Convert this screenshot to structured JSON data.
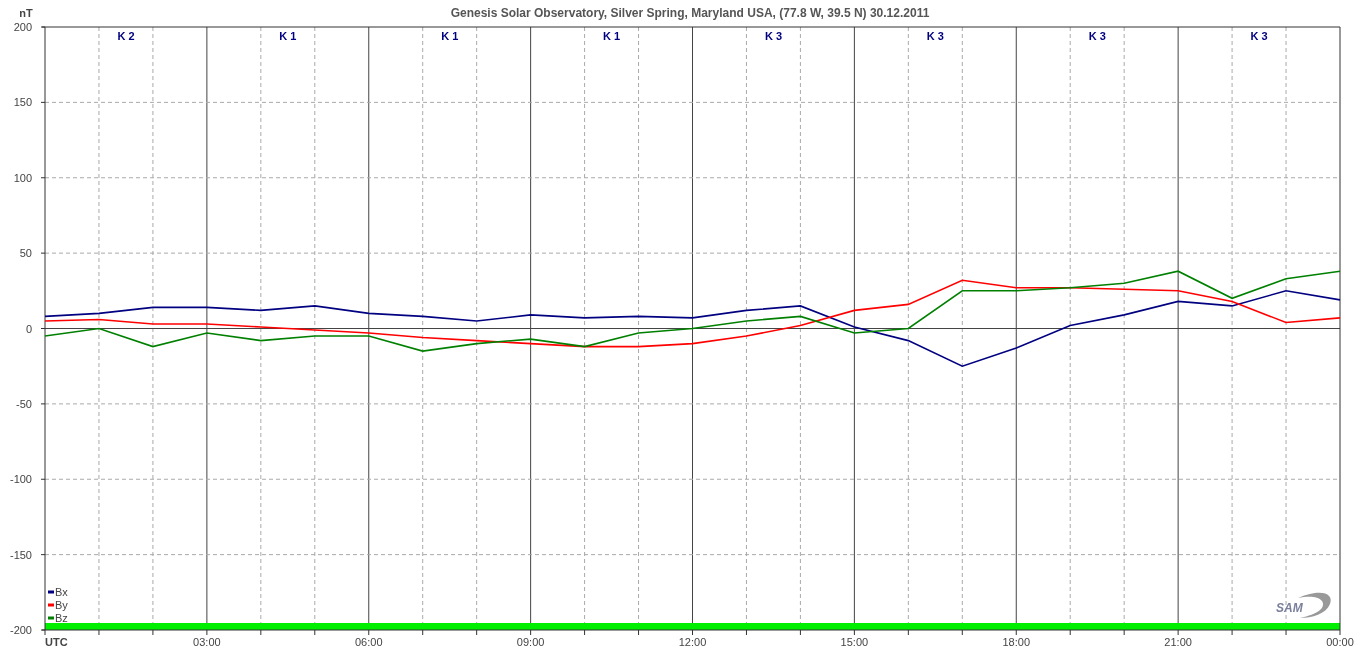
{
  "title": "Genesis Solar Observatory, Silver Spring, Maryland USA, (77.8 W, 39.5 N)  30.12.2011",
  "k_indices": [
    {
      "label": "K 2"
    },
    {
      "label": "K 1"
    },
    {
      "label": "K 1"
    },
    {
      "label": "K 1"
    },
    {
      "label": "K 3"
    },
    {
      "label": "K 3"
    },
    {
      "label": "K 3"
    },
    {
      "label": "K 3"
    }
  ],
  "logo": "SAM",
  "chart_data": {
    "type": "line",
    "ylabel": "nT",
    "x": [
      0,
      1,
      2,
      3,
      4,
      5,
      6,
      7,
      8,
      9,
      10,
      11,
      12,
      13,
      14,
      15,
      16,
      17,
      18,
      19,
      20,
      21,
      22,
      23,
      24
    ],
    "xlim": [
      0,
      24
    ],
    "ylim": [
      -200,
      200
    ],
    "grid": true,
    "legend": "lower left",
    "xticks": [
      {
        "value": 0,
        "label": "UTC"
      },
      {
        "value": 3,
        "label": "03:00"
      },
      {
        "value": 6,
        "label": "06:00"
      },
      {
        "value": 9,
        "label": "09:00"
      },
      {
        "value": 12,
        "label": "12:00"
      },
      {
        "value": 15,
        "label": "15:00"
      },
      {
        "value": 18,
        "label": "18:00"
      },
      {
        "value": 21,
        "label": "21:00"
      },
      {
        "value": 24,
        "label": "00:00"
      }
    ],
    "yticks": [
      -200,
      -150,
      -100,
      -50,
      0,
      50,
      100,
      150,
      200
    ],
    "series": [
      {
        "name": "Bx",
        "color": "#000080",
        "values": [
          8,
          10,
          14,
          14,
          12,
          15,
          10,
          8,
          5,
          9,
          7,
          8,
          7,
          12,
          15,
          1,
          -8,
          -25,
          -13,
          2,
          9,
          18,
          15,
          25,
          19
        ]
      },
      {
        "name": "By",
        "color": "#ff0000",
        "values": [
          5,
          6,
          3,
          3,
          1,
          -1,
          -3,
          -6,
          -8,
          -10,
          -12,
          -12,
          -10,
          -5,
          2,
          12,
          16,
          32,
          27,
          27,
          26,
          25,
          18,
          4,
          7
        ]
      },
      {
        "name": "Bz",
        "color": "#008000",
        "values": [
          -5,
          0,
          -12,
          -3,
          -8,
          -5,
          -5,
          -15,
          -10,
          -7,
          -12,
          -3,
          0,
          5,
          8,
          -3,
          0,
          25,
          25,
          27,
          30,
          38,
          20,
          33,
          38
        ]
      }
    ]
  }
}
